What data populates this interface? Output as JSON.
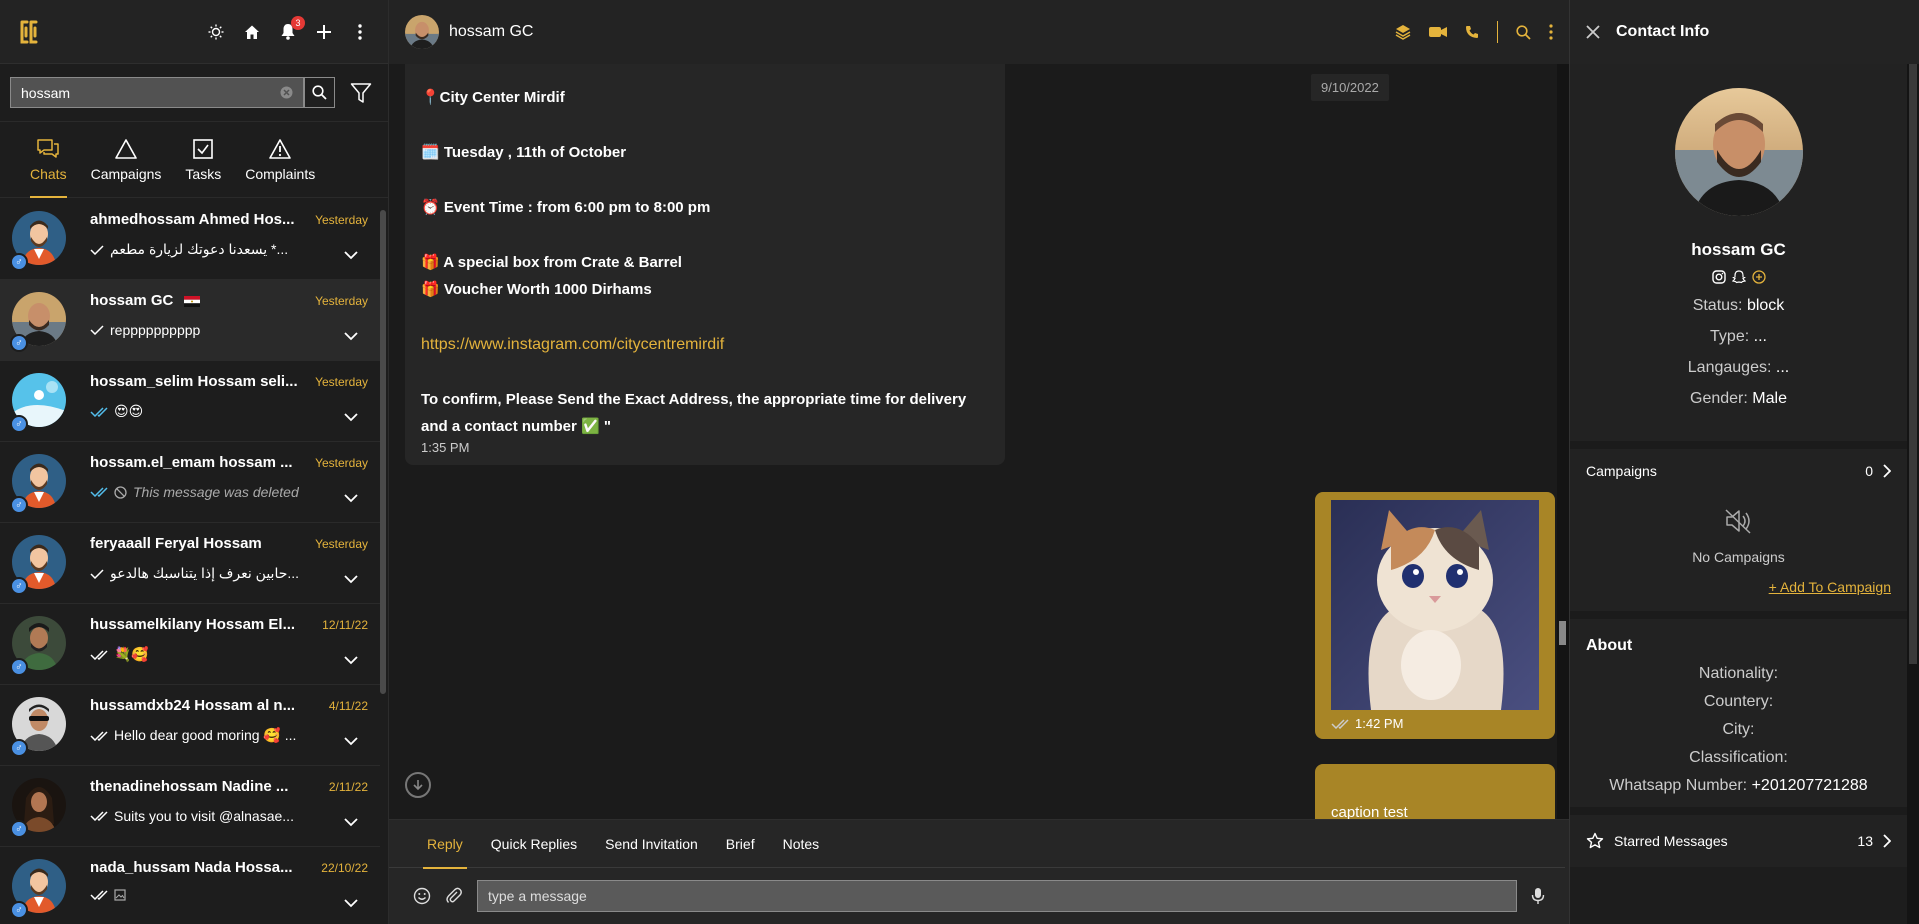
{
  "left": {
    "notifications_count": "3",
    "search": {
      "value": "hossam",
      "placeholder": ""
    },
    "tabs": [
      {
        "label": "Chats",
        "icon": "chats-icon"
      },
      {
        "label": "Campaigns",
        "icon": "triangle-icon"
      },
      {
        "label": "Tasks",
        "icon": "checkbox-icon"
      },
      {
        "label": "Complaints",
        "icon": "warning-icon"
      }
    ],
    "chats": [
      {
        "name": "ahmedhossam Ahmed Hos...",
        "date": "Yesterday",
        "preview": "يسعدنا دعوتك لزيارة مطعم *...",
        "ticks": "single"
      },
      {
        "name": "hossam GC",
        "flag": "egypt-flag",
        "date": "Yesterday",
        "preview": "repppppppppp",
        "ticks": "single"
      },
      {
        "name": "hossam_selim Hossam seli...",
        "date": "Yesterday",
        "preview": "😍😍",
        "ticks": "double-blue"
      },
      {
        "name": "hossam.el_emam hossam ...",
        "date": "Yesterday",
        "preview": "This message was deleted",
        "ticks": "double-blue",
        "deleted": true
      },
      {
        "name": "feryaaall Feryal Hossam",
        "date": "Yesterday",
        "preview": "حابين نعرف إذا يتناسبك هالدعو...",
        "ticks": "single"
      },
      {
        "name": "hussamelkilany Hossam El...",
        "date": "12/11/22",
        "preview": "💐🥰",
        "ticks": "double"
      },
      {
        "name": "hussamdxb24 Hossam al n...",
        "date": "4/11/22",
        "preview": "Hello dear good moring 🥰 ...",
        "ticks": "double"
      },
      {
        "name": "thenadinehossam Nadine ...",
        "date": "2/11/22",
        "preview": "Suits you to visit @alnasae...",
        "ticks": "double"
      },
      {
        "name": "nada_hussam Nada Hossa...",
        "date": "22/10/22",
        "preview": "",
        "ticks": "double"
      }
    ]
  },
  "middle": {
    "contact_name": "hossam GC",
    "date_pill": "9/10/2022",
    "incoming": {
      "line1": "📍City Center Mirdif",
      "line2": "🗓️ Tuesday , 11th of October",
      "line3": "⏰ Event Time : from 6:00 pm to 8:00 pm",
      "line4": "🎁 A special box from Crate & Barrel",
      "line5": "🎁 Voucher Worth 1000 Dirhams",
      "link": "https://www.instagram.com/citycentremirdif",
      "line6": "To confirm, Please Send the Exact Address, the appropriate time for delivery and a contact number ✅ \"",
      "time": "1:35 PM"
    },
    "outgoing": {
      "time": "1:42 PM",
      "caption": "caption test"
    },
    "composer": {
      "tabs": [
        "Reply",
        "Quick Replies",
        "Send Invitation",
        "Brief",
        "Notes"
      ],
      "placeholder": "type a message"
    }
  },
  "right": {
    "title": "Contact Info",
    "name": "hossam GC",
    "status_label": "Status:",
    "status_value": "block",
    "type_label": "Type:",
    "type_value": "...",
    "languages_label": "Langauges:",
    "languages_value": "...",
    "gender_label": "Gender:",
    "gender_value": "Male",
    "campaigns_label": "Campaigns",
    "campaigns_count": "0",
    "no_campaigns": "No Campaigns",
    "add_campaign": "+ Add To Campaign",
    "about_title": "About",
    "nationality_label": "Nationality:",
    "country_label": "Countery:",
    "city_label": "City:",
    "classification_label": "Classification:",
    "whatsapp_label": "Whatsapp Number:",
    "whatsapp_value": "+201207721288",
    "starred_label": "Starred Messages",
    "starred_count": "13"
  },
  "colors": {
    "accent": "#e4b33c",
    "outgoing_bubble": "#a88526",
    "panel": "#232323",
    "background": "#1b1b1b"
  }
}
